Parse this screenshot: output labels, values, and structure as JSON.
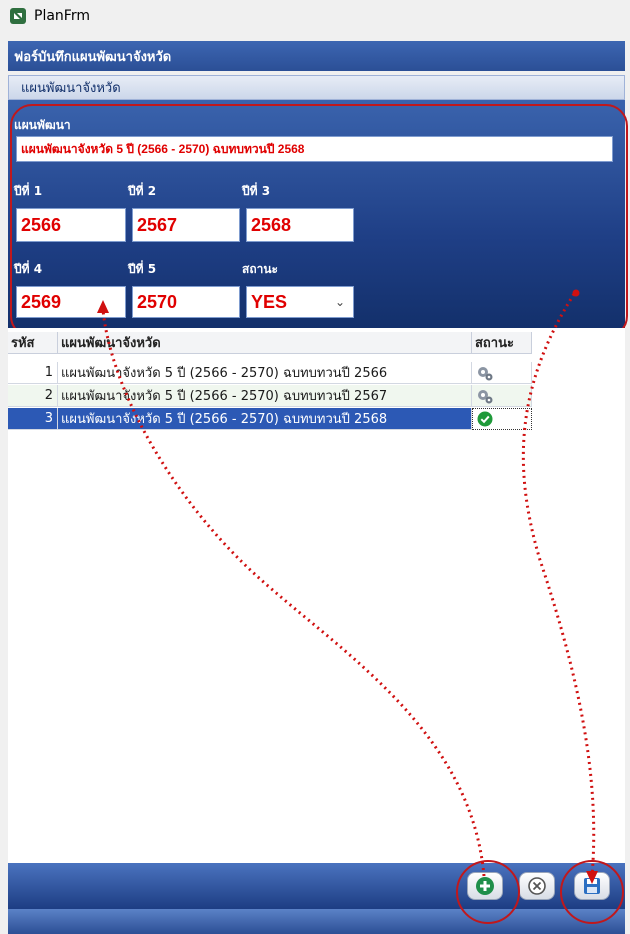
{
  "window": {
    "title": "PlanFrm"
  },
  "form": {
    "title": "ฟอร์บันทึกแผนพัฒนาจังหวัด"
  },
  "group": {
    "title": "แผนพัฒนาจังหวัด"
  },
  "editor": {
    "plan_label": "แผนพัฒนา",
    "plan_value": "แผนพัฒนาจังหวัด 5 ปี (2566 - 2570) ฉบทบทวนปี 2568",
    "year1_label": "ปีที่ 1",
    "year1_value": "2566",
    "year2_label": "ปีที่ 2",
    "year2_value": "2567",
    "year3_label": "ปีที่ 3",
    "year3_value": "2568",
    "year4_label": "ปีที่ 4",
    "year4_value": "2569",
    "year5_label": "ปีที่ 5",
    "year5_value": "2570",
    "status_label": "สถานะ",
    "status_value": "YES"
  },
  "grid": {
    "columns": [
      "รหัส",
      "แผนพัฒนาจังหวัด",
      "สถานะ"
    ],
    "rows": [
      {
        "id": "1",
        "name": "แผนพัฒนาจังหวัด 5 ปี (2566 - 2570) ฉบทบทวนปี 2566",
        "status_icon": "gears-icon"
      },
      {
        "id": "2",
        "name": "แผนพัฒนาจังหวัด 5 ปี (2566 - 2570) ฉบทบทวนปี 2567",
        "status_icon": "gears-icon"
      },
      {
        "id": "3",
        "name": "แผนพัฒนาจังหวัด 5 ปี (2566 - 2570) ฉบทบทวนปี 2568",
        "status_icon": "check-circle-icon"
      }
    ],
    "selected_row": 3
  },
  "toolbar": {
    "buttons": [
      "add-icon",
      "cancel-icon",
      "save-icon"
    ]
  },
  "colors": {
    "header_blue": "#2b4f96",
    "value_red": "#e00000",
    "annotation_red": "#c0181c",
    "selection_blue": "#2c59b5",
    "check_green": "#1f9a3a"
  }
}
